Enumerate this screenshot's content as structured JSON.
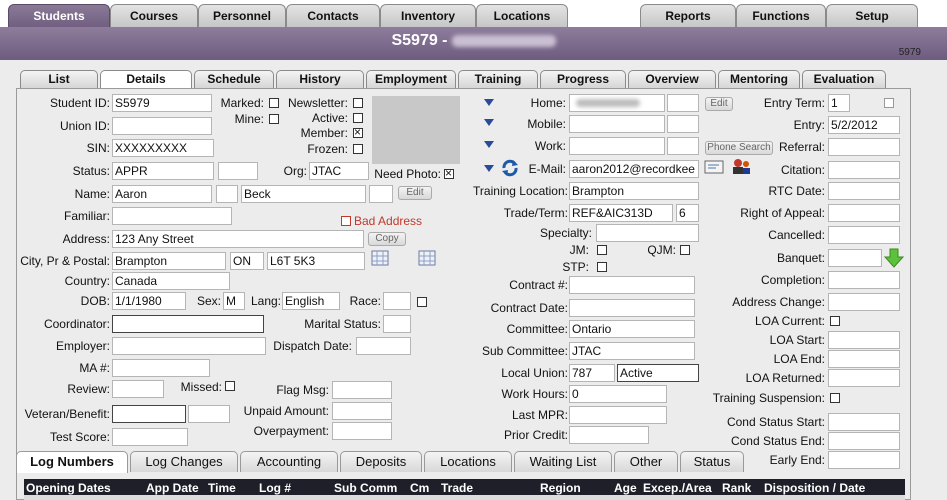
{
  "top_tabs": [
    "Students",
    "Courses",
    "Personnel",
    "Contacts",
    "Inventory",
    "Locations",
    "Reports",
    "Functions",
    "Setup"
  ],
  "title": "S5979 -",
  "record_id": "5979",
  "sub_tabs": [
    "List",
    "Details",
    "Schedule",
    "History",
    "Employment",
    "Training",
    "Progress",
    "Overview",
    "Mentoring",
    "Evaluation"
  ],
  "left": {
    "student_id_label": "Student ID:",
    "student_id": "S5979",
    "union_id_label": "Union ID:",
    "sin_label": "SIN:",
    "sin": "XXXXXXXXX",
    "status_label": "Status:",
    "status": "APPR",
    "org_label": "Org:",
    "org": "JTAC",
    "name_label": "Name:",
    "first_name": "Aaron",
    "last_name": "Beck",
    "edit_label": "Edit",
    "familiar_label": "Familiar:",
    "bad_address_label": "Bad Address",
    "address_label": "Address:",
    "address": "123 Any Street",
    "copy_label": "Copy",
    "city_label": "City, Pr & Postal:",
    "city": "Brampton",
    "province": "ON",
    "postal": "L6T 5K3",
    "country_label": "Country:",
    "country": "Canada",
    "dob_label": "DOB:",
    "dob": "1/1/1980",
    "sex_label": "Sex:",
    "sex": "M",
    "lang_label": "Lang:",
    "lang": "English",
    "race_label": "Race:",
    "coordinator_label": "Coordinator:",
    "marital_label": "Marital Status:",
    "employer_label": "Employer:",
    "dispatch_label": "Dispatch Date:",
    "ma_label": "MA #:",
    "review_label": "Review:",
    "missed_label": "Missed:",
    "flag_label": "Flag Msg:",
    "veteran_label": "Veteran/Benefit:",
    "unpaid_label": "Unpaid Amount:",
    "test_label": "Test Score:",
    "overpayment_label": "Overpayment:"
  },
  "flags": {
    "marked_label": "Marked:",
    "mine_label": "Mine:",
    "newsletter_label": "Newsletter:",
    "active_label": "Active:",
    "member_label": "Member:",
    "frozen_label": "Frozen:",
    "need_photo_label": "Need Photo:"
  },
  "middle": {
    "home_label": "Home:",
    "mobile_label": "Mobile:",
    "work_label": "Work:",
    "phone_search_label": "Phone Search",
    "email_label": "E-Mail:",
    "email": "aaron2012@recordkee",
    "training_location_label": "Training Location:",
    "training_location": "Brampton",
    "trade_label": "Trade/Term:",
    "trade": "REF&AIC313D",
    "term": "6",
    "specialty_label": "Specialty:",
    "jm_label": "JM:",
    "qjm_label": "QJM:",
    "stp_label": "STP:",
    "contract_label": "Contract #:",
    "contract_date_label": "Contract Date:",
    "committee_label": "Committee:",
    "committee": "Ontario",
    "sub_committee_label": "Sub Committee:",
    "sub_committee": "JTAC",
    "local_union_label": "Local Union:",
    "local_union": "787",
    "local_union_status": "Active",
    "work_hours_label": "Work Hours:",
    "work_hours": "0",
    "last_mpr_label": "Last MPR:",
    "prior_credit_label": "Prior Credit:"
  },
  "right": {
    "entry_term_label": "Entry Term:",
    "entry_term": "1",
    "entry_label": "Entry:",
    "entry": "5/2/2012",
    "referral_label": "Referral:",
    "citation_label": "Citation:",
    "rtc_label": "RTC Date:",
    "appeal_label": "Right of Appeal:",
    "cancelled_label": "Cancelled:",
    "banquet_label": "Banquet:",
    "completion_label": "Completion:",
    "address_change_label": "Address Change:",
    "loa_current_label": "LOA Current:",
    "loa_start_label": "LOA Start:",
    "loa_end_label": "LOA End:",
    "loa_returned_label": "LOA Returned:",
    "training_suspension_label": "Training Suspension:",
    "cond_start_label": "Cond Status Start:",
    "cond_end_label": "Cond Status End:",
    "early_end_label": "Early End:"
  },
  "bottom_tabs": [
    "Log Numbers",
    "Log Changes",
    "Accounting",
    "Deposits",
    "Locations",
    "Waiting List",
    "Other",
    "Status"
  ],
  "grid_headers": [
    "Opening Dates",
    "App Date",
    "Time",
    "Log #",
    "Sub Comm",
    "Cm",
    "Trade",
    "Region",
    "Age",
    "Excep./Area",
    "Rank",
    "Disposition / Date"
  ]
}
